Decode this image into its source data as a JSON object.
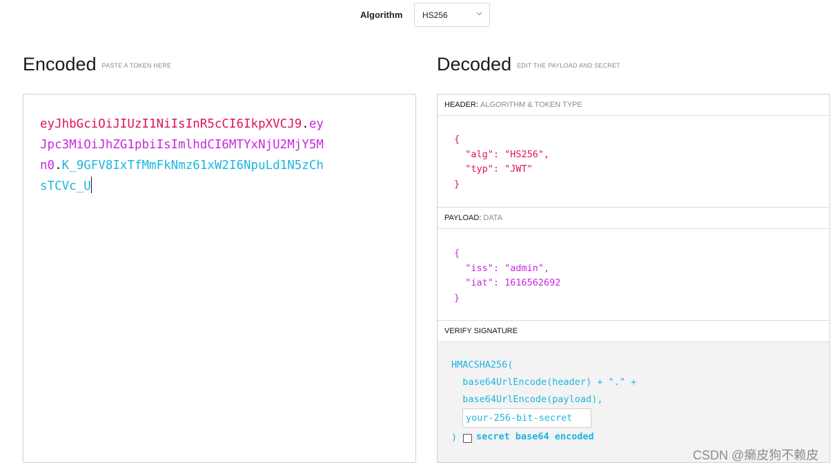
{
  "algorithm": {
    "label": "Algorithm",
    "selected": "HS256"
  },
  "encoded": {
    "title": "Encoded",
    "subtitle": "PASTE A TOKEN HERE",
    "token": {
      "header_lines": [
        "eyJhbGciOiJIUzI1NiIsInR5cCI6IkpXVCJ9"
      ],
      "dot1": ".",
      "payload_part1": "ey",
      "payload_line2": "Jpc3MiOiJhZG1pbiIsImlhdCI6MTYxNjU2MjY5M",
      "payload_line3": "n0",
      "dot2": ".",
      "signature_part1": "K_9GFV8IxTfMmFkNmz61xW2I6NpuLd1N5zCh",
      "signature_line4": "sTCVc_U"
    }
  },
  "decoded": {
    "title": "Decoded",
    "subtitle": "EDIT THE PAYLOAD AND SECRET",
    "header_section": {
      "label": "HEADER:",
      "sublabel": "ALGORITHM & TOKEN TYPE",
      "lines": [
        "{",
        "  \"alg\": \"HS256\",",
        "  \"typ\": \"JWT\"",
        "}"
      ]
    },
    "payload_section": {
      "label": "PAYLOAD:",
      "sublabel": "DATA",
      "lines": [
        "{",
        "  \"iss\": \"admin\",",
        "  \"iat\": 1616562692",
        "}"
      ]
    },
    "verify_section": {
      "label": "VERIFY SIGNATURE",
      "line1": "HMACSHA256(",
      "line2": "  base64UrlEncode(header) + \".\" +",
      "line3": "  base64UrlEncode(payload),",
      "secret_placeholder": "your-256-bit-secret",
      "close_paren": ")",
      "checkbox_label": "secret base64 encoded",
      "checkbox_checked": false
    }
  },
  "watermark": "CSDN @癞皮狗不赖皮",
  "colors": {
    "header": "#e0115f",
    "payload": "#c827e0",
    "signature": "#1cb5e0"
  }
}
